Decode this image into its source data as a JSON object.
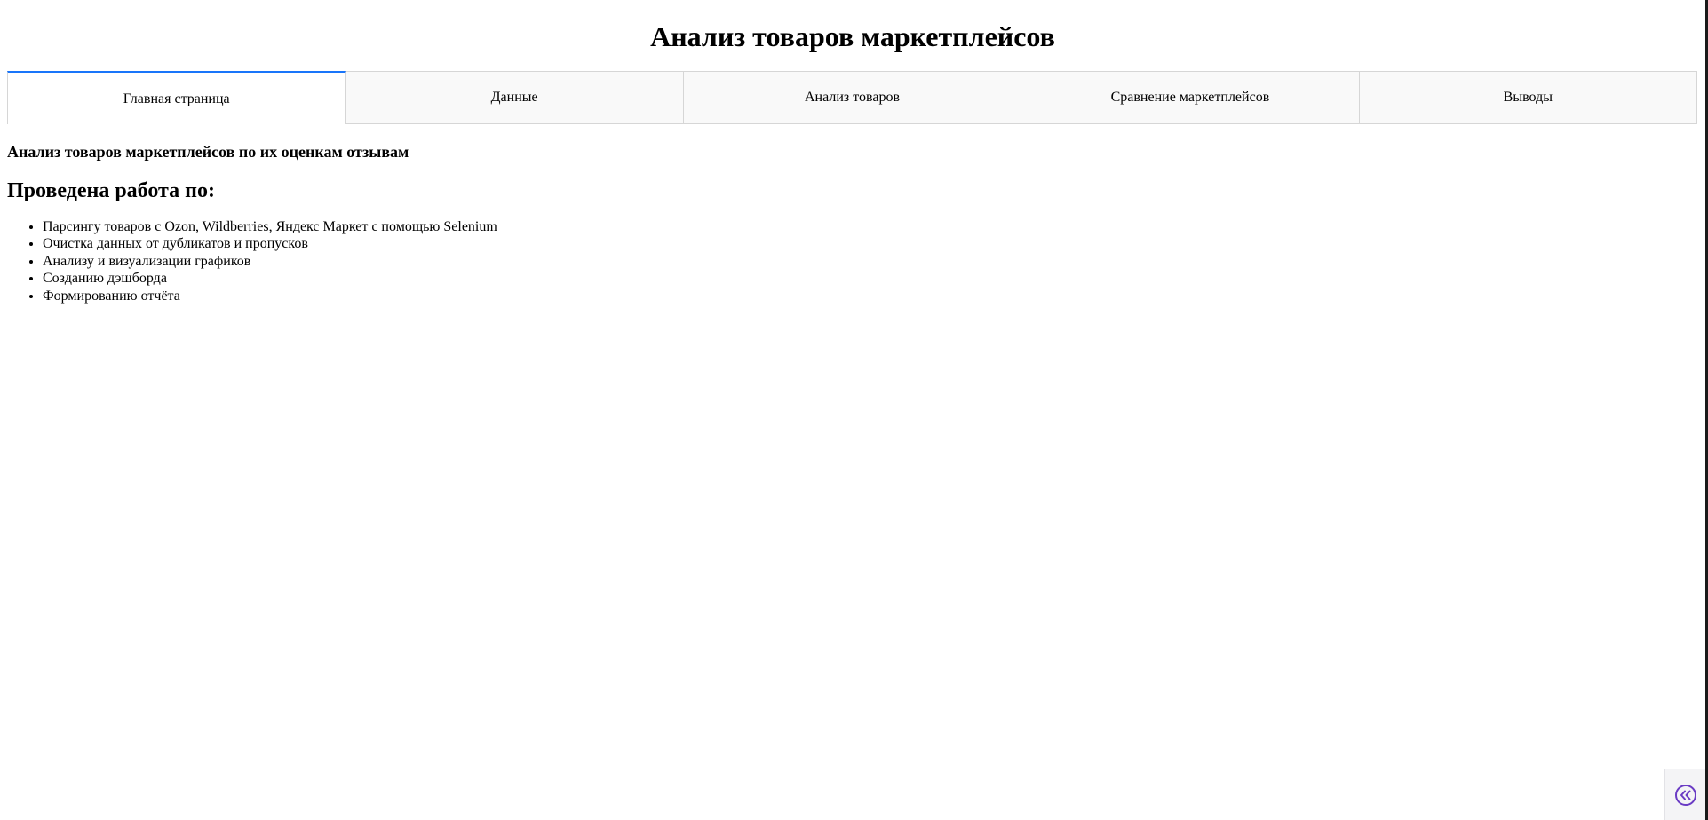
{
  "header": {
    "title": "Анализ товаров маркетплейсов"
  },
  "tabs": [
    {
      "label": "Главная страница",
      "active": true
    },
    {
      "label": "Данные",
      "active": false
    },
    {
      "label": "Анализ товаров",
      "active": false
    },
    {
      "label": "Сравнение маркетплейсов",
      "active": false
    },
    {
      "label": "Выводы",
      "active": false
    }
  ],
  "main": {
    "subtitle": "Анализ товаров маркетплейсов по их оценкам отзывам",
    "section_heading": "Проведена работа по:",
    "items": [
      "Парсингу товаров с Ozon, Wildberries, Яндекс Маркет с помощью Selenium",
      "Очистка данных от дубликатов и пропусков",
      "Анализу и визуализации графиков",
      "Созданию дэшборда",
      "Формированию отчёта"
    ]
  },
  "colors": {
    "accent": "#1975fa",
    "tab_bg": "#f9f9f9",
    "tab_border": "#d6d6d6",
    "collapse_icon": "#6a3bc4"
  },
  "icons": {
    "collapse": "double-chevron-left-icon"
  }
}
